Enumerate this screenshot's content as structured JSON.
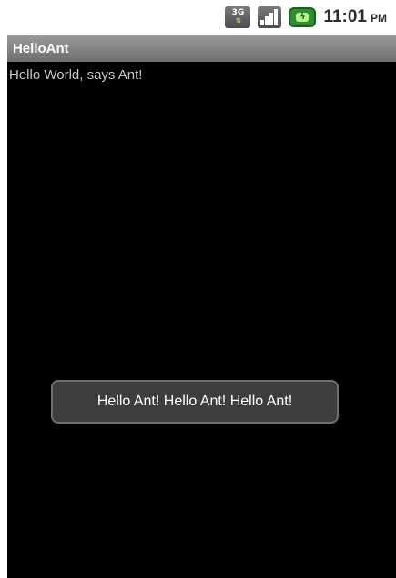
{
  "status_bar": {
    "network_label": "3G",
    "clock_time": "11:01",
    "clock_ampm": "PM"
  },
  "app": {
    "title": "HelloAnt",
    "message": "Hello World, says Ant!"
  },
  "toast": {
    "text": "Hello Ant! Hello Ant! Hello Ant!"
  }
}
